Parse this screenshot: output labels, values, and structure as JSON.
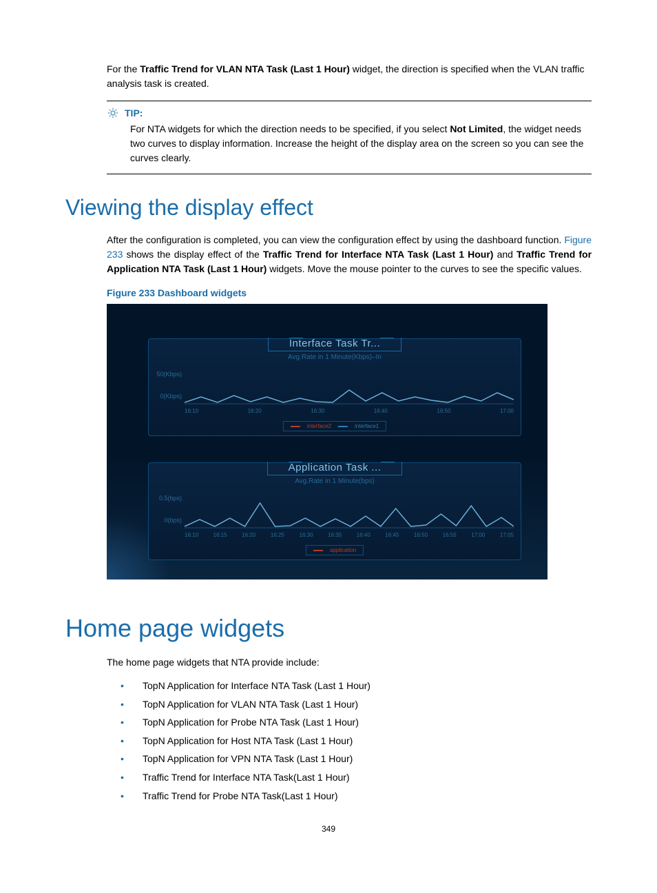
{
  "intro": {
    "pre": "For the ",
    "bold": "Traffic Trend for VLAN NTA Task (Last 1 Hour)",
    "post": " widget, the direction is specified when the VLAN traffic analysis task is created."
  },
  "tip": {
    "label": "TIP:",
    "text_pre": "For NTA widgets for which the direction needs to be specified, if you select ",
    "text_bold": "Not Limited",
    "text_post": ", the widget needs two curves to display information. Increase the height of the display area on the screen so you can see the curves clearly."
  },
  "section1": {
    "title": "Viewing the display effect",
    "p_pre": "After the configuration is completed, you can view the configuration effect by using the dashboard function. ",
    "p_link": "Figure 233",
    "p_mid": " shows the display effect of the ",
    "p_bold1": "Traffic Trend for Interface NTA Task (Last 1 Hour)",
    "p_and": " and ",
    "p_bold2": "Traffic Trend for Application NTA Task (Last 1 Hour)",
    "p_post": " widgets. Move the mouse pointer to the curves to see the specific values."
  },
  "figure": {
    "caption": "Figure 233 Dashboard widgets",
    "panel1": {
      "title": "Interface Task Tr...",
      "subtitle": "Avg.Rate in 1 Minute(Kbps)–In",
      "ylabels": [
        "50(Kbps)",
        "0(Kbps)"
      ],
      "legend1": "interface2",
      "legend2": "interface1"
    },
    "panel2": {
      "title": "Application Task ...",
      "subtitle": "Avg.Rate in 1 Minute(bps)",
      "ylabels": [
        "0.5(bps)",
        "0(bps)"
      ],
      "legend1": "application"
    }
  },
  "section2": {
    "title": "Home page widgets",
    "intro": "The home page widgets that NTA provide include:",
    "items": [
      "TopN Application for Interface NTA Task (Last 1 Hour)",
      "TopN Application for VLAN NTA Task (Last 1 Hour)",
      "TopN Application for Probe NTA Task (Last 1 Hour)",
      "TopN Application for Host NTA Task (Last 1 Hour)",
      "TopN Application for VPN NTA Task (Last 1 Hour)",
      "Traffic Trend for Interface NTA Task(Last 1 Hour)",
      "Traffic Trend for Probe NTA Task(Last 1 Hour)"
    ]
  },
  "page_number": "349",
  "chart_data": [
    {
      "type": "line",
      "title": "Interface Task Tr...",
      "subtitle": "Avg.Rate in 1 Minute(Kbps)–In",
      "ylabel": "Kbps",
      "ylim": [
        0,
        50
      ],
      "x_ticks": [
        "16:10",
        "16:20",
        "16:30",
        "16:40",
        "16:50",
        "17:00"
      ],
      "series": [
        {
          "name": "interface2",
          "color": "#b63c2c",
          "values": [
            8,
            14,
            7,
            16,
            9,
            14,
            6,
            12,
            8,
            6,
            22,
            8,
            18,
            9,
            15,
            10,
            6,
            14,
            8,
            18,
            10
          ]
        },
        {
          "name": "interface1",
          "color": "#2a7fb5",
          "values": [
            6,
            10,
            6,
            12,
            7,
            11,
            6,
            10,
            7,
            6,
            14,
            8,
            13,
            8,
            11,
            8,
            6,
            11,
            7,
            13,
            8
          ]
        }
      ]
    },
    {
      "type": "line",
      "title": "Application Task ...",
      "subtitle": "Avg.Rate in 1 Minute(bps)",
      "ylabel": "bps",
      "ylim": [
        0,
        0.5
      ],
      "x_ticks": [
        "16:10",
        "16:15",
        "16:20",
        "16:25",
        "16:30",
        "16:35",
        "16:40",
        "16:45",
        "16:50",
        "16:55",
        "17:00",
        "17:05"
      ],
      "series": [
        {
          "name": "application",
          "color": "#b63c2c",
          "values": [
            0.05,
            0.18,
            0.06,
            0.22,
            0.05,
            0.45,
            0.05,
            0.06,
            0.2,
            0.05,
            0.18,
            0.05,
            0.24,
            0.06,
            0.35,
            0.05,
            0.06,
            0.28,
            0.06,
            0.4,
            0.05,
            0.22,
            0.05
          ]
        }
      ]
    }
  ]
}
